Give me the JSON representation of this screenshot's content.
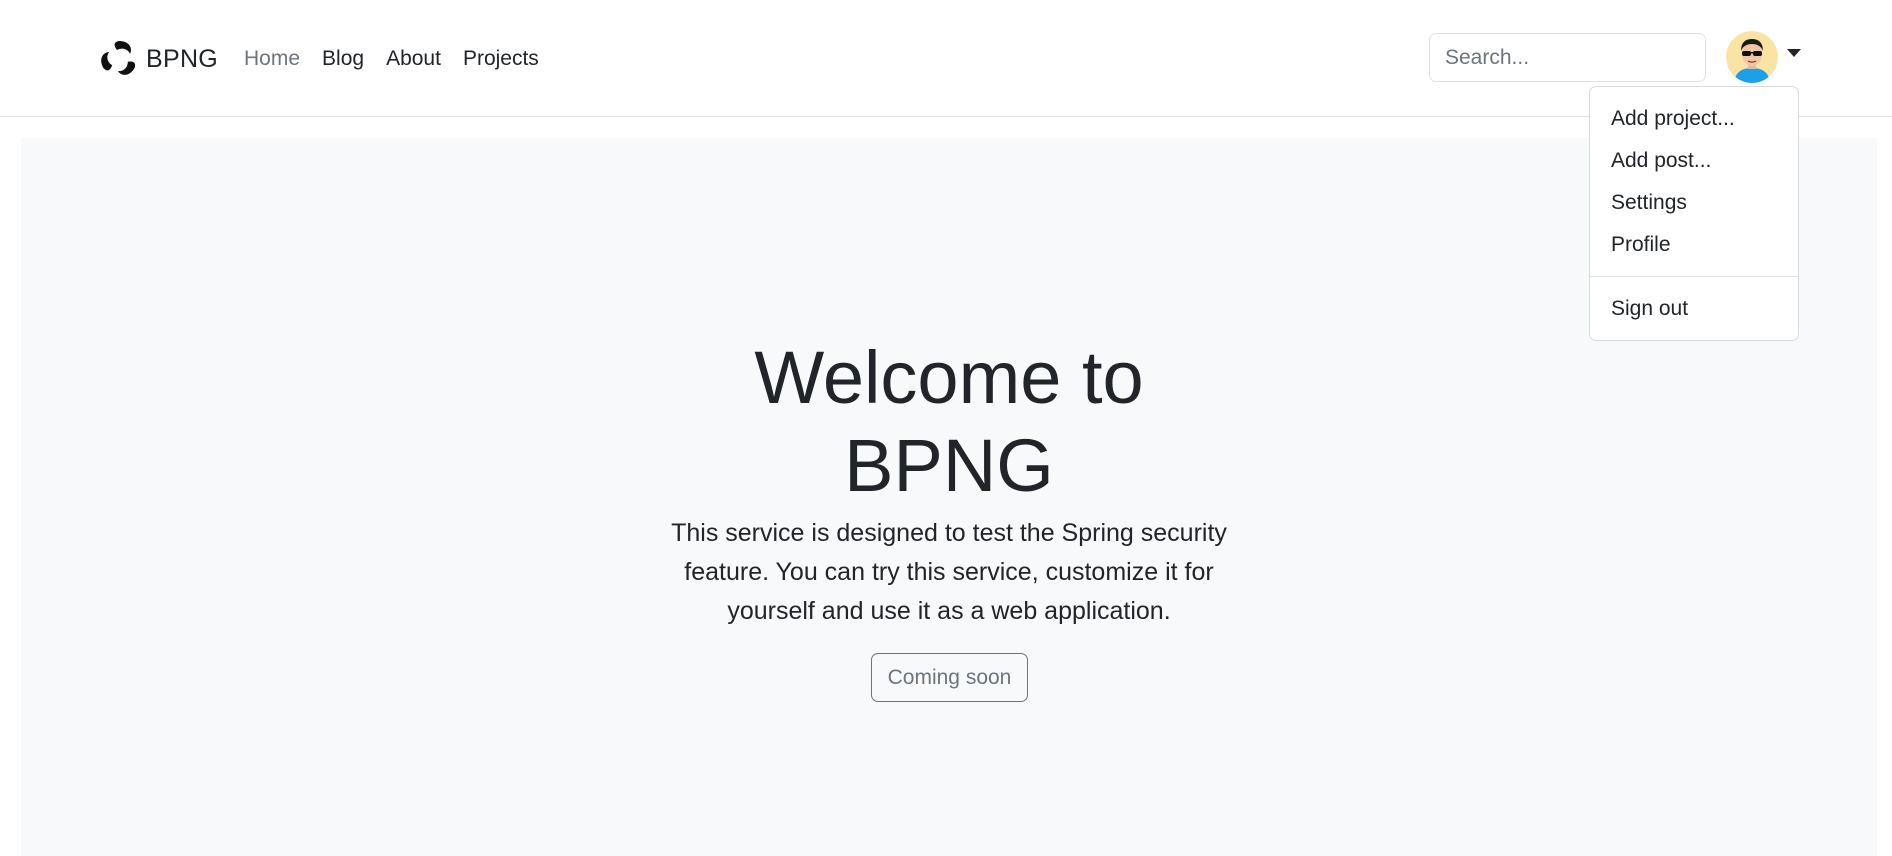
{
  "brand": {
    "name": "BPNG",
    "logo_icon": "swirl-logo-icon"
  },
  "nav": {
    "items": [
      {
        "label": "Home",
        "active": true
      },
      {
        "label": "Blog",
        "active": false
      },
      {
        "label": "About",
        "active": false
      },
      {
        "label": "Projects",
        "active": false
      }
    ]
  },
  "search": {
    "placeholder": "Search...",
    "value": ""
  },
  "user_menu": {
    "avatar_icon": "user-avatar-icon",
    "toggle_icon": "caret-down-icon",
    "items": [
      {
        "label": "Add project..."
      },
      {
        "label": "Add post..."
      },
      {
        "label": "Settings"
      },
      {
        "label": "Profile"
      }
    ],
    "sign_out": "Sign out"
  },
  "hero": {
    "title": "Welcome to BPNG",
    "description": "This service is designed to test the Spring security feature. You can try this service, customize it for yourself and use it as a web application.",
    "button_label": "Coming soon"
  },
  "colors": {
    "text": "#212529",
    "muted": "#6c757d",
    "hero_background": "#f8f9fa",
    "border": "#dee2e6"
  }
}
